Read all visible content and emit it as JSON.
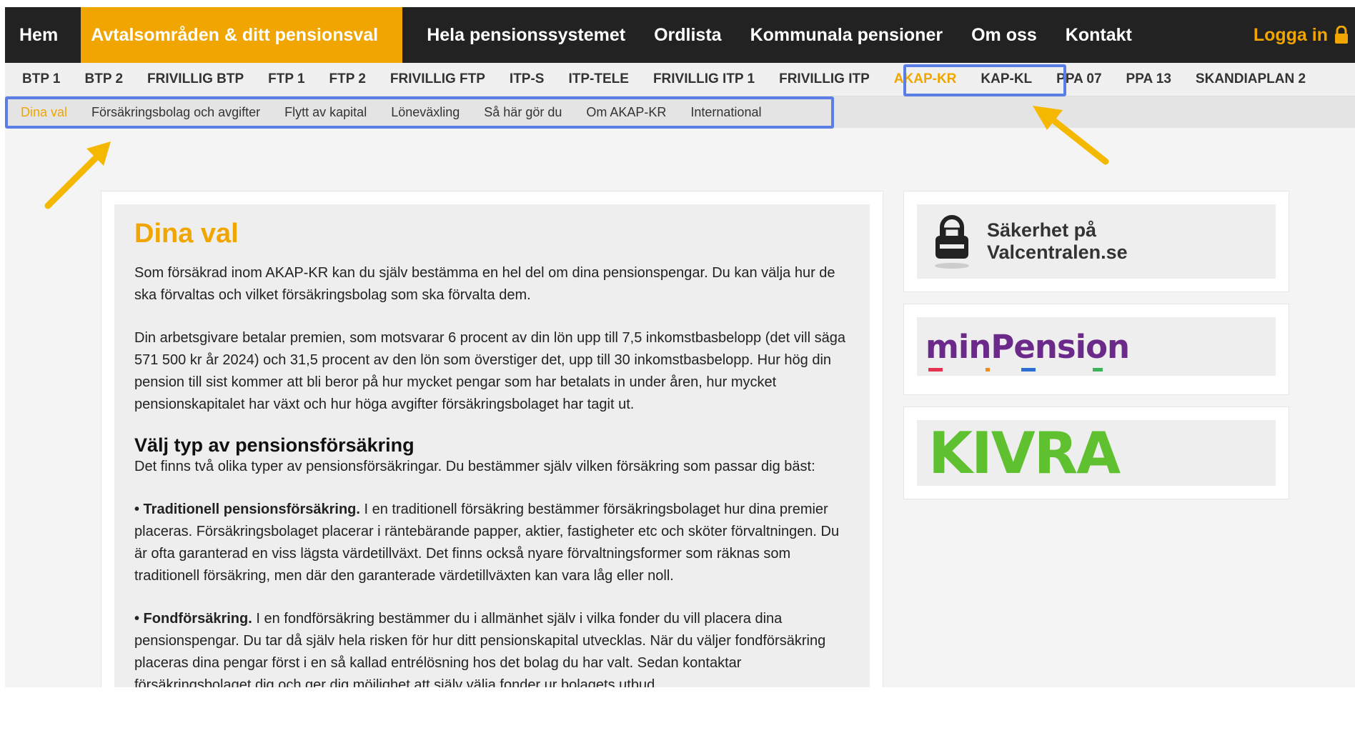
{
  "topnav": {
    "items": [
      "Hem",
      "Avtalsområden & ditt pensionsval",
      "Hela pensionssystemet",
      "Ordlista",
      "Kommunala pensioner",
      "Om oss",
      "Kontakt"
    ],
    "login": "Logga in"
  },
  "subnav": {
    "items": [
      "BTP 1",
      "BTP 2",
      "FRIVILLIG BTP",
      "FTP 1",
      "FTP 2",
      "FRIVILLIG FTP",
      "ITP-S",
      "ITP-TELE",
      "FRIVILLIG ITP 1",
      "FRIVILLIG ITP",
      "AKAP-KR",
      "KAP-KL",
      "PPA 07",
      "PPA 13",
      "SKANDIAPLAN 2"
    ]
  },
  "tertnav": {
    "items": [
      "Dina val",
      "Försäkringsbolag och avgifter",
      "Flytt av kapital",
      "Löneväxling",
      "Så här gör du",
      "Om AKAP-KR",
      "International"
    ]
  },
  "main": {
    "title": "Dina val",
    "p1": "Som försäkrad inom AKAP-KR kan du själv bestämma en hel del om dina pensionspengar. Du kan välja hur de ska förvaltas och vilket försäkringsbolag som ska förvalta dem.",
    "p2": "Din arbetsgivare betalar premien, som motsvarar 6 procent av din lön upp till 7,5 inkomstbasbelopp (det vill säga 571 500 kr år 2024) och 31,5 procent av den lön som överstiger det, upp till 30 inkomstbasbelopp. Hur hög din pension till sist kommer att bli beror på hur mycket pengar som har betalats in under åren, hur mycket pensionskapitalet har växt och hur höga avgifter försäkringsbolaget har tagit ut.",
    "h2": "Välj typ av pensionsförsäkring",
    "p3": "Det finns två olika typer av pensionsförsäkringar. Du bestämmer själv vilken försäkring som passar dig bäst:",
    "b1_title": "• Traditionell pensionsförsäkring.",
    "b1_text": " I en traditionell försäkring bestämmer försäkringsbolaget hur dina premier placeras. Försäkringsbolaget placerar i räntebärande papper, aktier, fastigheter etc och sköter förvaltningen. Du är ofta garanterad en viss lägsta värdetillväxt. Det finns också nyare förvaltningsformer som räknas som traditionell försäkring, men där den garanterade värdetillväxten kan vara låg eller noll.",
    "b2_title": "• Fondförsäkring.",
    "b2_text": " I en fondförsäkring bestämmer du i allmänhet själv i vilka fonder du vill placera dina pensionspengar. Du tar då själv hela risken för hur ditt pensionskapital utvecklas. När du väljer fondförsäkring placeras dina pengar först i en så kallad entrélösning hos det bolag du har valt. Sedan kontaktar försäkringsbolaget dig och ger dig möjlighet att själv välja fonder ur bolagets utbud."
  },
  "side": {
    "security_text": "Säkerhet på Valcentralen.se",
    "minpension": "minPension",
    "kivra": "KIVRA"
  },
  "colors": {
    "accent": "#f0a500",
    "topnav_bg": "#222222",
    "highlight": "#5b7ee6",
    "minpension": "#6b2a8a",
    "kivra": "#5fc12f"
  }
}
